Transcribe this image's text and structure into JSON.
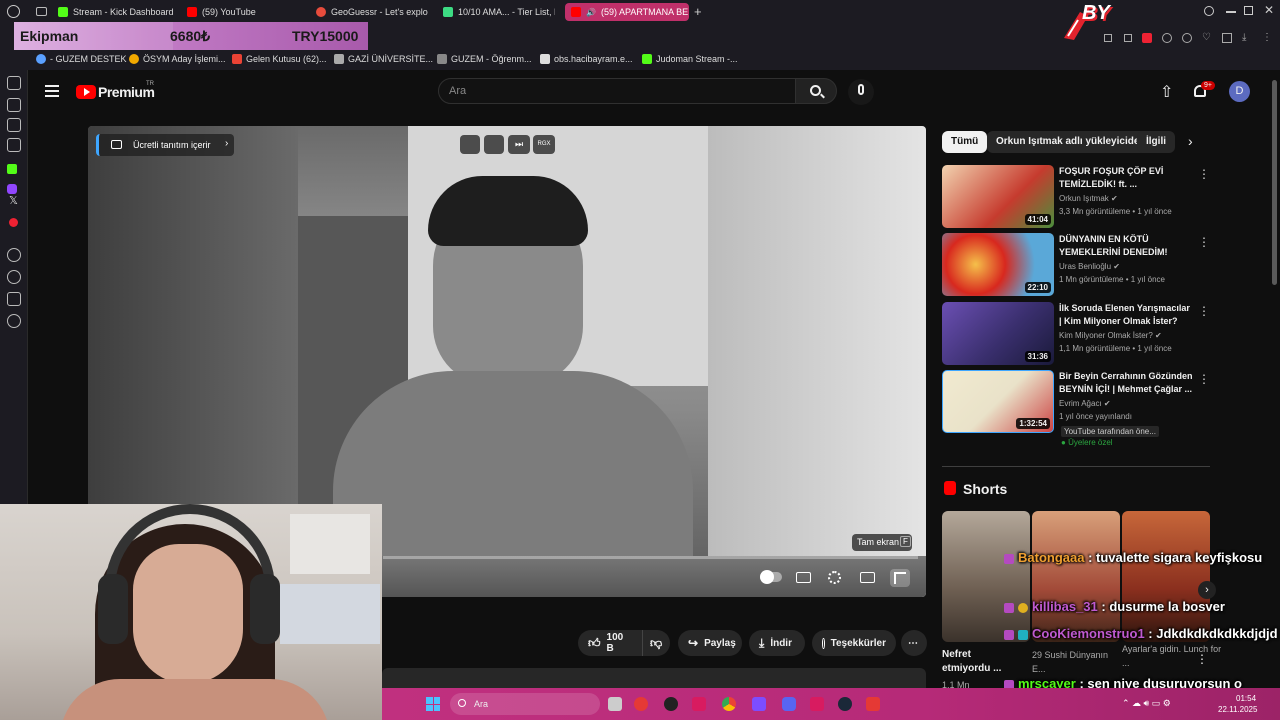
{
  "browser": {
    "tabs": [
      {
        "label": "Stream - Kick Dashboard",
        "color": "#53fc18"
      },
      {
        "label": "(59) YouTube",
        "color": "#ff0000"
      },
      {
        "label": "GeoGuessr - Let's explor",
        "color": "#e74c3c"
      },
      {
        "label": "10/10 AMA... - Tier List, K",
        "color": "#3ddc84"
      },
      {
        "label": "(59) APARTMANA BE",
        "color": "#ff0000"
      }
    ],
    "bookmarks": [
      {
        "label": "- GUZEM DESTEK",
        "color": "#5aa0ff"
      },
      {
        "label": "ÖSYM Aday İşlemi...",
        "color": "#f2a900"
      },
      {
        "label": "Gelen Kutusu (62)...",
        "color": "#ea4335"
      },
      {
        "label": "GAZİ ÜNİVERSİTE...",
        "color": "#aaaaaa"
      },
      {
        "label": "GUZEM - Öğrenm...",
        "color": "#888888"
      },
      {
        "label": "obs.hacibayram.e...",
        "color": "#dddddd"
      },
      {
        "label": "Judoman Stream -...",
        "color": "#53fc18"
      }
    ]
  },
  "overlay": {
    "donation_label": "Ekipman",
    "donation_current": "6680₺",
    "donation_goal": "TRY15000",
    "donation_progress": 0.45,
    "logo_text": "BY"
  },
  "youtube": {
    "brand": "Premium",
    "brand_sup": "TR",
    "search_placeholder": "Ara",
    "notif_count": "9+",
    "avatar_letter": "D",
    "video": {
      "promo_label": "Ücretli tanıtım içerir",
      "fullscreen_tooltip": "Tam ekran",
      "fullscreen_key": "F",
      "corner_badge": "RGX"
    },
    "actions": {
      "like_count": "100 B",
      "share": "Paylaş",
      "download": "İndir",
      "thanks": "Teşekkürler"
    },
    "chips": [
      "Tümü",
      "Orkun Işıtmak adlı yükleyiciden",
      "İlgili"
    ],
    "recommendations": [
      {
        "title": "FOŞUR FOŞUR ÇÖP EVİ TEMİZLEDİK! ft. ...",
        "channel": "Orkun Işıtmak",
        "meta": "3,3 Mn görüntüleme • 1 yıl önce",
        "duration": "41:04",
        "thumb": "#c63b2e"
      },
      {
        "title": "DÜNYANIN EN KÖTÜ YEMEKLERİNİ DENEDİM!",
        "channel": "Uras Benlioğlu",
        "meta": "1 Mn görüntüleme • 1 yıl önce",
        "duration": "22:10",
        "thumb": "#d8281e"
      },
      {
        "title": "İlk Soruda Elenen Yarışmacılar | Kim Milyoner Olmak İster?",
        "channel": "Kim Milyoner Olmak İster?",
        "meta": "1,1 Mn görüntüleme • 1 yıl önce",
        "duration": "31:36",
        "thumb": "#3a2f6e"
      },
      {
        "title": "Bir Beyin Cerrahının Gözünden BEYNİN İÇİ! | Mehmet Çağlar ...",
        "channel": "Evrim Ağacı",
        "meta": "1 yıl önce yayınlandı",
        "extra": "YouTube tarafından öne...",
        "members": "Üyelere özel",
        "duration": "1:32:54",
        "thumb": "#e9e2c9"
      }
    ],
    "shorts_title": "Shorts",
    "shorts": [
      {
        "title": "Nefret etmiyordu ...",
        "views": "1,1 Mn"
      },
      {
        "title": "29 Sushi Dünyanın E...",
        "views": ""
      },
      {
        "title": "Ayarlar'a gidin. Lunch for ...",
        "views": ""
      }
    ]
  },
  "chat": [
    {
      "user": "Batongaaa",
      "message": ": tuvalette sigara keyfişkosu",
      "color": "#f0a030",
      "badge": "#b44ac0"
    },
    {
      "user": "killibas_31",
      "message": ": dusurme la bosver",
      "color": "#c05ad0",
      "badge": "#e0b020"
    },
    {
      "user": "CooKiemonstruo1",
      "message": ": Jdkdkdkdkdkkdjdjd",
      "color": "#c05ad0",
      "badge": "#20b0c0"
    },
    {
      "user": "mrscayer",
      "message": ": sen niye dusuruyorsun o quality ayarlamali",
      "color": "#53fc18",
      "badge": "#b44ac0"
    }
  ],
  "taskbar": {
    "search": "Ara",
    "time": "01:54",
    "date": "22.11.2025"
  }
}
